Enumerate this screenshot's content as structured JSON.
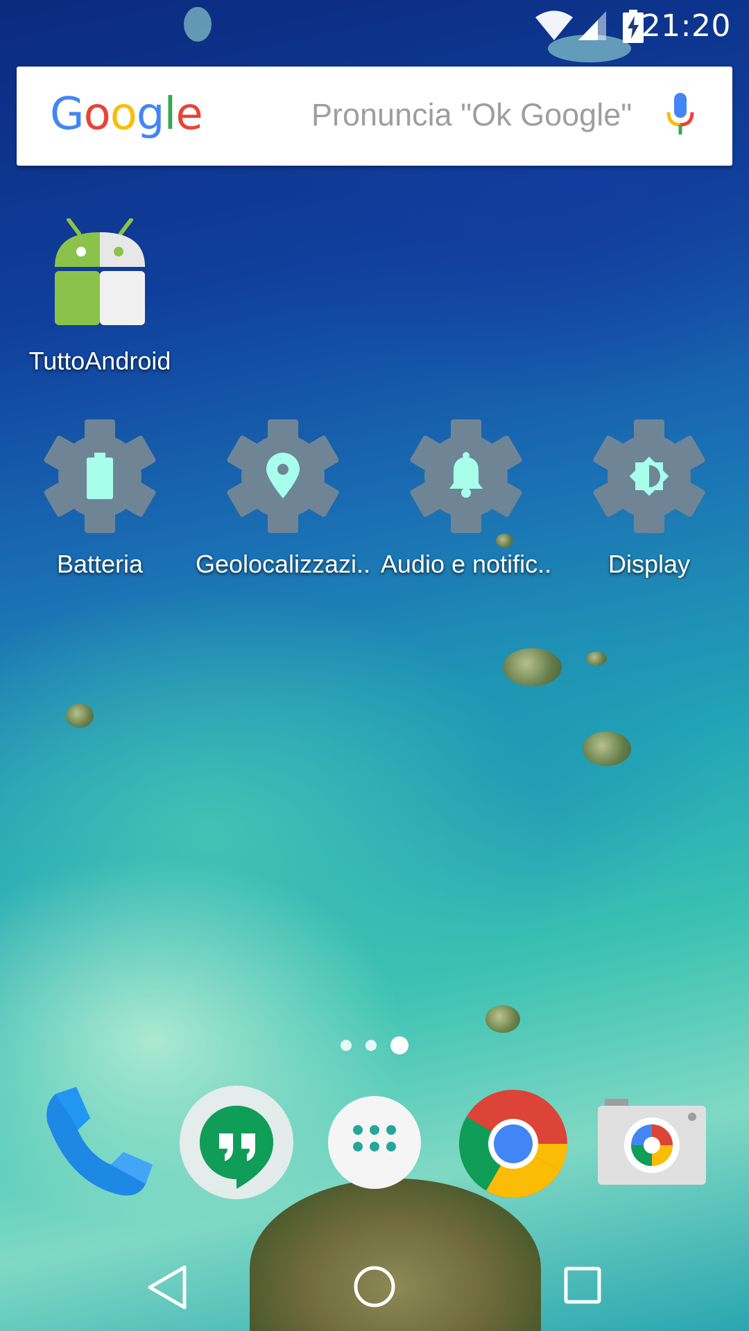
{
  "status_bar": {
    "time": "21:20",
    "icons": [
      "wifi-icon",
      "cell-signal-icon",
      "battery-charging-icon"
    ]
  },
  "search_bar": {
    "logo_text": [
      "G",
      "o",
      "o",
      "g",
      "l",
      "e"
    ],
    "logo_colors": [
      "#4285F4",
      "#EA4335",
      "#FBBC05",
      "#4285F4",
      "#34A853",
      "#EA4335"
    ],
    "hint": "Pronuncia \"Ok Google\"",
    "mic_icon": "mic-icon"
  },
  "home_apps": [
    {
      "label": "TuttoAndroid",
      "icon": "android-icon"
    }
  ],
  "shortcuts": [
    {
      "label": "Batteria",
      "icon": "battery-settings-icon"
    },
    {
      "label": "Geolocalizzazi..",
      "icon": "location-settings-icon"
    },
    {
      "label": "Audio e notific..",
      "icon": "bell-settings-icon"
    },
    {
      "label": "Display",
      "icon": "brightness-settings-icon"
    }
  ],
  "page_indicator": {
    "pages": 3,
    "current": 3
  },
  "dock": [
    {
      "name": "Phone",
      "icon": "phone-icon"
    },
    {
      "name": "Hangouts",
      "icon": "hangouts-icon"
    },
    {
      "name": "App drawer",
      "icon": "app-drawer-icon"
    },
    {
      "name": "Chrome",
      "icon": "chrome-icon"
    },
    {
      "name": "Camera",
      "icon": "camera-icon"
    }
  ],
  "nav_bar": [
    "back-icon",
    "home-icon",
    "recents-icon"
  ],
  "colors": {
    "shortcut_gear": "#6f8596",
    "shortcut_glyph": "#a7ffeb",
    "accent_blue": "#4285F4"
  }
}
